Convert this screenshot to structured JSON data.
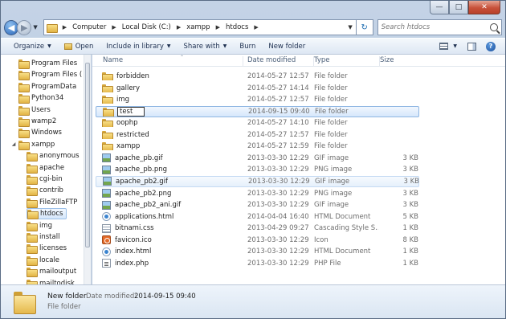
{
  "caption": {
    "minimize": "—",
    "maximize": "□",
    "close": "✕"
  },
  "nav": {
    "back_icon": "back-arrow-icon",
    "forward_icon": "forward-arrow-icon"
  },
  "address": {
    "breadcrumbs": [
      "Computer",
      "Local Disk (C:)",
      "xampp",
      "htdocs"
    ],
    "separator": "▶"
  },
  "search": {
    "placeholder": "Search htdocs"
  },
  "toolbar": {
    "organize": "Organize",
    "open": "Open",
    "include_in_library": "Include in library",
    "share_with": "Share with",
    "burn": "Burn",
    "new_folder": "New folder"
  },
  "sidebar": {
    "items": [
      {
        "label": "Program Files",
        "level": 0
      },
      {
        "label": "Program Files (",
        "level": 0
      },
      {
        "label": "ProgramData",
        "level": 0
      },
      {
        "label": "Python34",
        "level": 0
      },
      {
        "label": "Users",
        "level": 0
      },
      {
        "label": "wamp2",
        "level": 0
      },
      {
        "label": "Windows",
        "level": 0
      },
      {
        "label": "xampp",
        "level": 0,
        "expanded": true
      },
      {
        "label": "anonymous",
        "level": 1
      },
      {
        "label": "apache",
        "level": 1
      },
      {
        "label": "cgi-bin",
        "level": 1
      },
      {
        "label": "contrib",
        "level": 1
      },
      {
        "label": "FileZillaFTP",
        "level": 1
      },
      {
        "label": "htdocs",
        "level": 1,
        "selected": true
      },
      {
        "label": "img",
        "level": 1
      },
      {
        "label": "install",
        "level": 1
      },
      {
        "label": "licenses",
        "level": 1
      },
      {
        "label": "locale",
        "level": 1
      },
      {
        "label": "mailoutput",
        "level": 1
      },
      {
        "label": "mailtodisk",
        "level": 1
      }
    ]
  },
  "columns": {
    "name": "Name",
    "date_modified": "Date modified",
    "type": "Type",
    "size": "Size"
  },
  "files": [
    {
      "name": "forbidden",
      "date": "2014-05-27 12:57",
      "type": "File folder",
      "size": "",
      "icon": "folder"
    },
    {
      "name": "gallery",
      "date": "2014-05-27 14:14",
      "type": "File folder",
      "size": "",
      "icon": "folder"
    },
    {
      "name": "img",
      "date": "2014-05-27 12:57",
      "type": "File folder",
      "size": "",
      "icon": "folder"
    },
    {
      "name": "test",
      "date": "2014-09-15 09:40",
      "type": "File folder",
      "size": "",
      "icon": "folder",
      "renaming": true
    },
    {
      "name": "oophp",
      "date": "2014-05-27 14:10",
      "type": "File folder",
      "size": "",
      "icon": "folder"
    },
    {
      "name": "restricted",
      "date": "2014-05-27 12:57",
      "type": "File folder",
      "size": "",
      "icon": "folder"
    },
    {
      "name": "xampp",
      "date": "2014-05-27 12:59",
      "type": "File folder",
      "size": "",
      "icon": "folder"
    },
    {
      "name": "apache_pb.gif",
      "date": "2013-03-30 12:29",
      "type": "GIF image",
      "size": "3 KB",
      "icon": "image"
    },
    {
      "name": "apache_pb.png",
      "date": "2013-03-30 12:29",
      "type": "PNG image",
      "size": "3 KB",
      "icon": "image"
    },
    {
      "name": "apache_pb2.gif",
      "date": "2013-03-30 12:29",
      "type": "GIF image",
      "size": "3 KB",
      "icon": "image",
      "hover": true
    },
    {
      "name": "apache_pb2.png",
      "date": "2013-03-30 12:29",
      "type": "PNG image",
      "size": "3 KB",
      "icon": "image"
    },
    {
      "name": "apache_pb2_ani.gif",
      "date": "2013-03-30 12:29",
      "type": "GIF image",
      "size": "3 KB",
      "icon": "image"
    },
    {
      "name": "applications.html",
      "date": "2014-04-04 16:40",
      "type": "HTML Document",
      "size": "5 KB",
      "icon": "html"
    },
    {
      "name": "bitnami.css",
      "date": "2013-04-29 09:27",
      "type": "Cascading Style S...",
      "size": "1 KB",
      "icon": "css"
    },
    {
      "name": "favicon.ico",
      "date": "2013-03-30 12:29",
      "type": "Icon",
      "size": "8 KB",
      "icon": "favicon"
    },
    {
      "name": "index.html",
      "date": "2013-03-30 12:29",
      "type": "HTML Document",
      "size": "1 KB",
      "icon": "html"
    },
    {
      "name": "index.php",
      "date": "2013-03-30 12:29",
      "type": "PHP File",
      "size": "1 KB",
      "icon": "php"
    }
  ],
  "details": {
    "name": "New folder",
    "modified_label": "Date modified:",
    "modified_value": "2014-09-15 09:40",
    "type": "File folder"
  }
}
